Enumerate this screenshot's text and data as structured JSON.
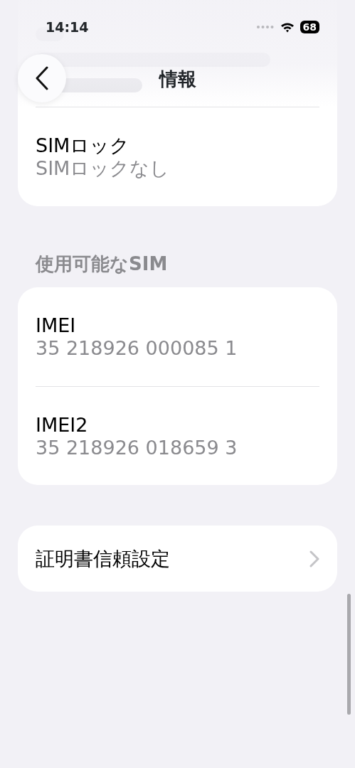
{
  "status_bar": {
    "time": "14:14",
    "battery": "68"
  },
  "nav": {
    "title": "情報"
  },
  "sections": [
    {
      "rows": [
        {
          "kind": "info",
          "label": "SIMロック",
          "value": "SIMロックなし"
        }
      ]
    },
    {
      "header": "使用可能なSIM",
      "rows": [
        {
          "kind": "info",
          "label": "IMEI",
          "value": "35 218926 000085 1"
        },
        {
          "kind": "info",
          "label": "IMEI2",
          "value": "35 218926 018659 3"
        }
      ]
    },
    {
      "rows": [
        {
          "kind": "link",
          "label": "証明書信頼設定"
        }
      ]
    }
  ]
}
